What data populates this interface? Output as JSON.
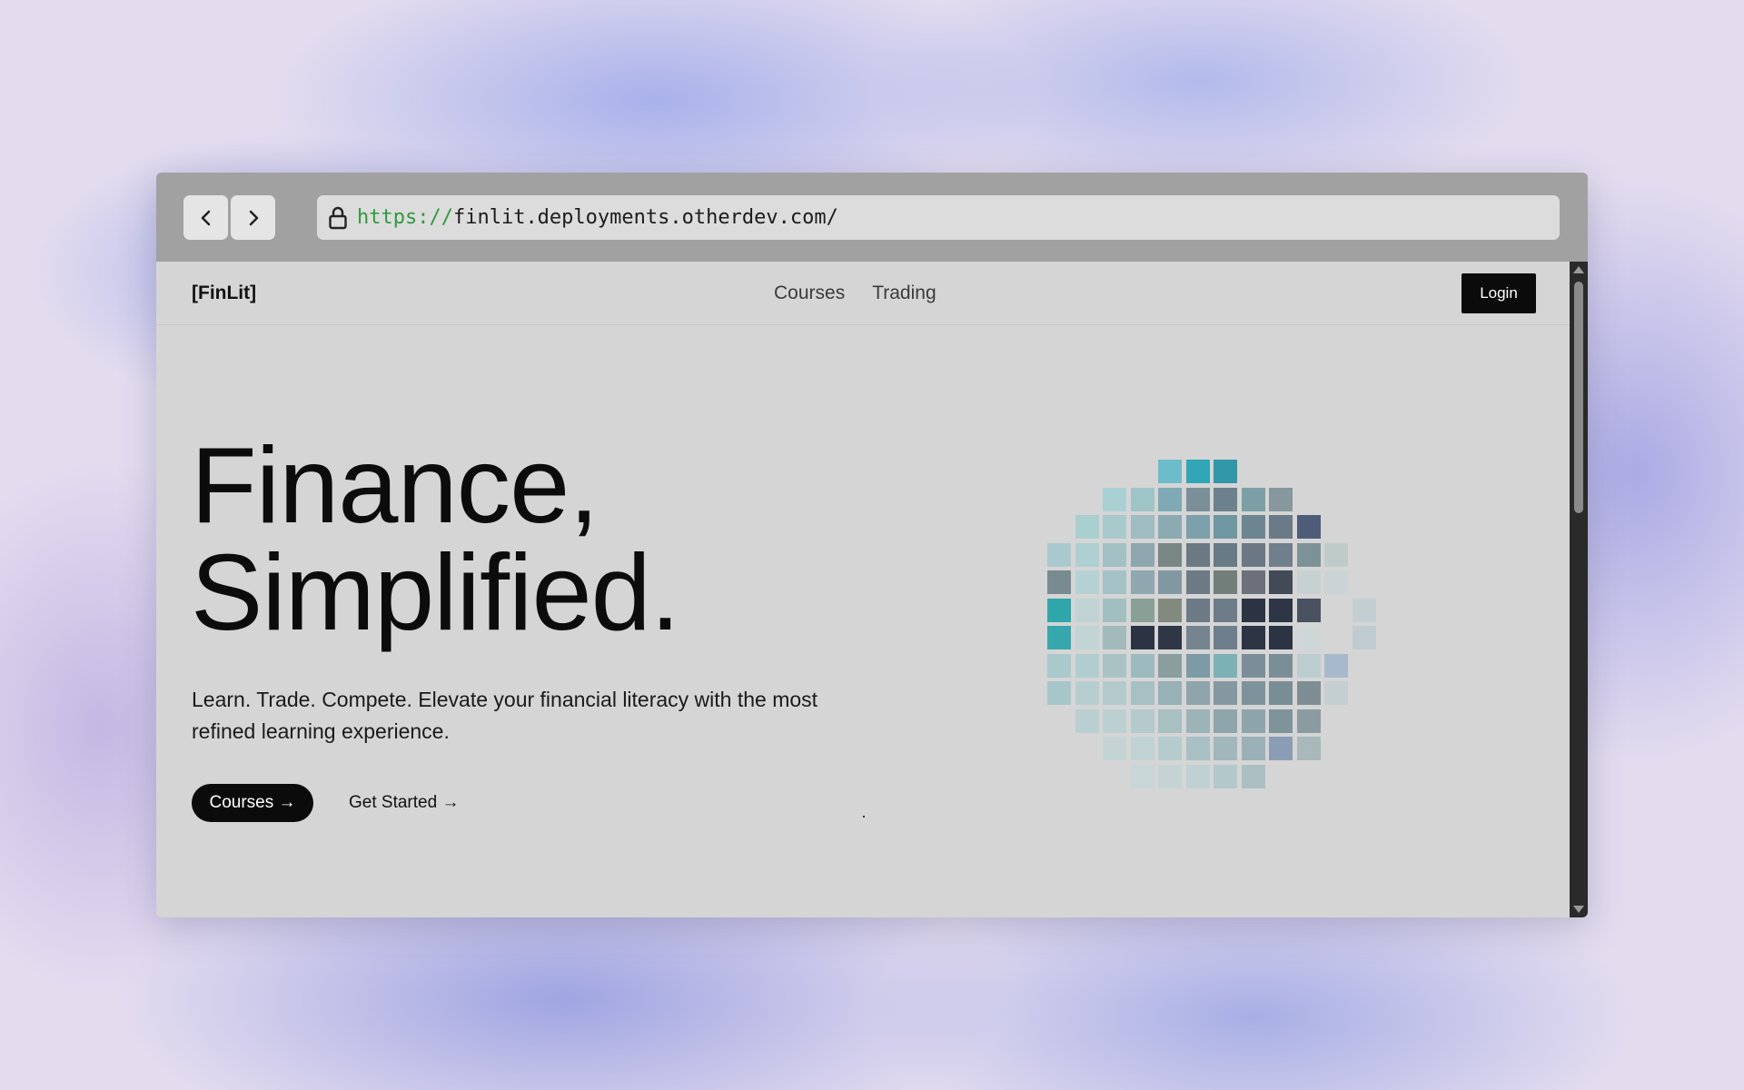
{
  "browser": {
    "url_protocol": "https://",
    "url_rest": "finlit.deployments.otherdev.com/"
  },
  "site": {
    "logo": "[FinLit]",
    "nav": [
      "Courses",
      "Trading"
    ],
    "login_label": "Login"
  },
  "hero": {
    "title_line1": "Finance,",
    "title_line2": "Simplified.",
    "subtitle": "Learn. Trade. Compete. Elevate your financial literacy with the most refined learning experience.",
    "primary_cta": "Courses →",
    "secondary_cta": "Get Started →"
  },
  "mosaic": {
    "rows": [
      [
        [
          4,
          "#6cbcca"
        ],
        [
          5,
          "#30a6b6"
        ],
        [
          6,
          "#3297a8"
        ]
      ],
      [
        [
          2,
          "#a9d0d2"
        ],
        [
          3,
          "#9fc4c8"
        ],
        [
          4,
          "#7fa9b5"
        ],
        [
          5,
          "#7b8f99"
        ],
        [
          6,
          "#6c818d"
        ],
        [
          7,
          "#7c9fa6"
        ],
        [
          8,
          "#86979d"
        ]
      ],
      [
        [
          1,
          "#aacfd1"
        ],
        [
          2,
          "#a8cacc"
        ],
        [
          3,
          "#9ebcc2"
        ],
        [
          4,
          "#8caab1"
        ],
        [
          5,
          "#7ca0ab"
        ],
        [
          6,
          "#6e97a2"
        ],
        [
          7,
          "#6d8591"
        ],
        [
          8,
          "#6a7a87"
        ],
        [
          9,
          "#4e5c7a"
        ]
      ],
      [
        [
          0,
          "#aac9cf"
        ],
        [
          1,
          "#aed0d2"
        ],
        [
          2,
          "#a3c0c4"
        ],
        [
          3,
          "#8ea6ae"
        ],
        [
          4,
          "#788784"
        ],
        [
          5,
          "#6b7a82"
        ],
        [
          6,
          "#677a86"
        ],
        [
          7,
          "#6b7884"
        ],
        [
          8,
          "#6f7f8c"
        ],
        [
          9,
          "#7d9297"
        ],
        [
          10,
          "#bfcbc9"
        ]
      ],
      [
        [
          0,
          "#778b90"
        ],
        [
          1,
          "#b6d1d4"
        ],
        [
          2,
          "#a4c2c6"
        ],
        [
          3,
          "#8fa7ae"
        ],
        [
          4,
          "#8198a3"
        ],
        [
          5,
          "#6b7a85"
        ],
        [
          6,
          "#727e7a"
        ],
        [
          7,
          "#6b707b"
        ],
        [
          8,
          "#424a58"
        ],
        [
          9,
          "#c7d1d2"
        ],
        [
          10,
          "#cbd3d6"
        ]
      ],
      [
        [
          0,
          "#2fa6aa"
        ],
        [
          1,
          "#bfd3d4"
        ],
        [
          2,
          "#a1bfc0"
        ],
        [
          3,
          "#8a9f96"
        ],
        [
          4,
          "#828a7e"
        ],
        [
          5,
          "#6b7a84"
        ],
        [
          6,
          "#6d7c88"
        ],
        [
          7,
          "#2c3444"
        ],
        [
          8,
          "#2e3544"
        ],
        [
          9,
          "#4a5262"
        ],
        [
          11,
          "#c3ced3"
        ]
      ],
      [
        [
          0,
          "#36a7ac"
        ],
        [
          1,
          "#c1d4d6"
        ],
        [
          2,
          "#a2babb"
        ],
        [
          3,
          "#2c3443"
        ],
        [
          4,
          "#2f3747"
        ],
        [
          5,
          "#76848f"
        ],
        [
          6,
          "#6f7e8c"
        ],
        [
          7,
          "#2d3545"
        ],
        [
          8,
          "#2c3443"
        ],
        [
          9,
          "#cfd6d8"
        ],
        [
          11,
          "#bfcbd1"
        ]
      ],
      [
        [
          0,
          "#a9c9cb"
        ],
        [
          1,
          "#b2cdcf"
        ],
        [
          2,
          "#a9c3c4"
        ],
        [
          3,
          "#9dbabe"
        ],
        [
          4,
          "#8a9e9f"
        ],
        [
          5,
          "#7e9aa4"
        ],
        [
          6,
          "#7cb1b6"
        ],
        [
          7,
          "#7b8d99"
        ],
        [
          8,
          "#7b8e98"
        ],
        [
          9,
          "#bccdd0"
        ],
        [
          10,
          "#a7bacb"
        ]
      ],
      [
        [
          0,
          "#a7c6c9"
        ],
        [
          1,
          "#b6ced0"
        ],
        [
          2,
          "#b3cacd"
        ],
        [
          3,
          "#a7c0c3"
        ],
        [
          4,
          "#97b1b6"
        ],
        [
          5,
          "#8fa4ab"
        ],
        [
          6,
          "#8597a0"
        ],
        [
          7,
          "#7e929c"
        ],
        [
          8,
          "#798d97"
        ],
        [
          9,
          "#7e8d93"
        ],
        [
          10,
          "#c4cfd1"
        ]
      ],
      [
        [
          1,
          "#b9cfd1"
        ],
        [
          2,
          "#bcd0d2"
        ],
        [
          3,
          "#b4cacc"
        ],
        [
          4,
          "#a9c0c3"
        ],
        [
          5,
          "#9cb3b7"
        ],
        [
          6,
          "#8fa5ac"
        ],
        [
          7,
          "#8ea4ab"
        ],
        [
          8,
          "#7f939b"
        ],
        [
          9,
          "#8b9ba1"
        ]
      ],
      [
        [
          2,
          "#c4d4d5"
        ],
        [
          3,
          "#c1d2d4"
        ],
        [
          4,
          "#b6cbcd"
        ],
        [
          5,
          "#a8c0c3"
        ],
        [
          6,
          "#a1b7bb"
        ],
        [
          7,
          "#9bb0b6"
        ],
        [
          8,
          "#8b9db4"
        ],
        [
          9,
          "#a8b8bb"
        ]
      ],
      [
        [
          3,
          "#c9d6d7"
        ],
        [
          4,
          "#c4d4d5"
        ],
        [
          5,
          "#bfd1d2"
        ],
        [
          6,
          "#b3c8ca"
        ],
        [
          7,
          "#abbfc3"
        ]
      ]
    ]
  }
}
